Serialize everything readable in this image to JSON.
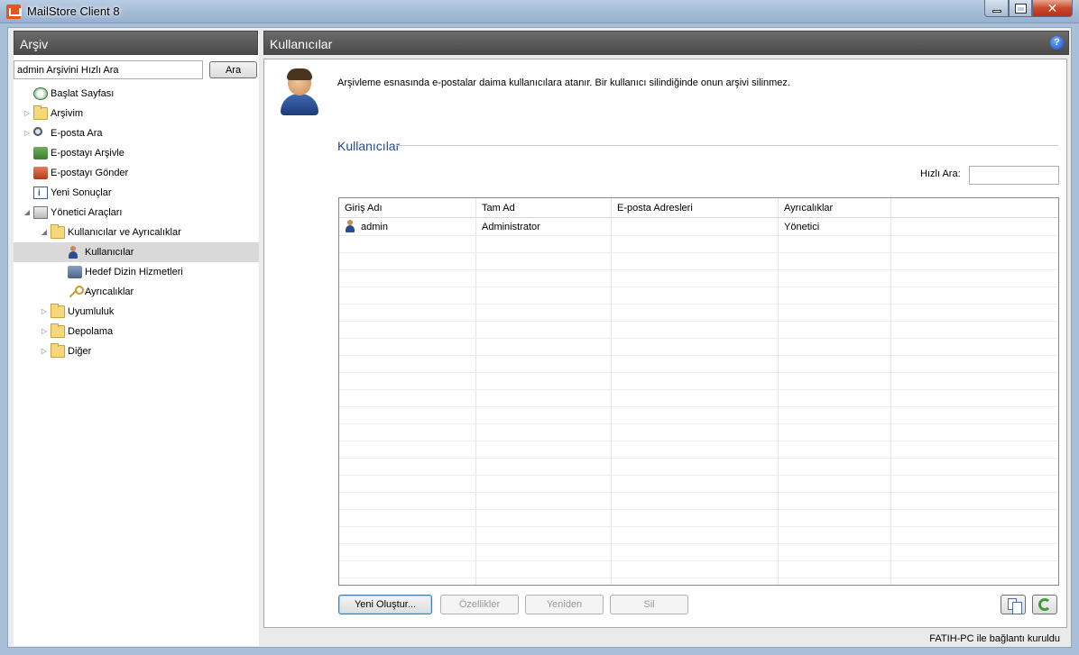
{
  "window": {
    "title": "MailStore Client 8"
  },
  "left": {
    "header": "Arşiv",
    "search_value": "admin Arşivini Hızlı Ara",
    "search_button": "Ara",
    "tree": [
      {
        "label": "Başlat Sayfası",
        "icon": "start-page-icon",
        "level": 0,
        "expander": "none"
      },
      {
        "label": "Arşivim",
        "icon": "folder-icon",
        "level": 0,
        "expander": "collapsed"
      },
      {
        "label": "E-posta Ara",
        "icon": "search-icon",
        "level": 0,
        "expander": "collapsed"
      },
      {
        "label": "E-postayı Arşivle",
        "icon": "archive-email-icon",
        "level": 0,
        "expander": "none"
      },
      {
        "label": "E-postayı Gönder",
        "icon": "send-email-icon",
        "level": 0,
        "expander": "none"
      },
      {
        "label": "Yeni Sonuçlar",
        "icon": "new-results-icon",
        "level": 0,
        "expander": "none"
      },
      {
        "label": "Yönetici Araçları",
        "icon": "admin-tools-icon",
        "level": 0,
        "expander": "expanded"
      },
      {
        "label": "Kullanıcılar ve Ayrıcalıklar",
        "icon": "folder-icon",
        "level": 1,
        "expander": "expanded"
      },
      {
        "label": "Kullanıcılar",
        "icon": "user-icon",
        "level": 2,
        "expander": "none",
        "selected": true
      },
      {
        "label": "Hedef Dizin Hizmetleri",
        "icon": "directory-services-icon",
        "level": 2,
        "expander": "none"
      },
      {
        "label": "Ayrıcalıklar",
        "icon": "key-icon",
        "level": 2,
        "expander": "none"
      },
      {
        "label": "Uyumluluk",
        "icon": "folder-icon",
        "level": 1,
        "expander": "collapsed"
      },
      {
        "label": "Depolama",
        "icon": "folder-icon",
        "level": 1,
        "expander": "collapsed"
      },
      {
        "label": "Diğer",
        "icon": "folder-icon",
        "level": 1,
        "expander": "collapsed"
      }
    ]
  },
  "right": {
    "header": "Kullanıcılar",
    "info": "Arşivleme esnasında e-postalar daima kullanıcılara atanır. Bir kullanıcı silindiğinde onun arşivi silinmez.",
    "section_title": "Kullanıcılar",
    "filter_label": "Hızlı Ara:",
    "filter_value": "",
    "columns": [
      "Giriş Adı",
      "Tam Ad",
      "E-posta Adresleri",
      "Ayrıcalıklar",
      ""
    ],
    "rows": [
      {
        "login": "admin",
        "full_name": "Administrator",
        "emails": "",
        "privileges": "Yönetici"
      }
    ],
    "buttons": {
      "create": "Yeni Oluştur...",
      "properties": "Özellikler",
      "rename": "Yeniden",
      "delete": "Sil"
    }
  },
  "status": {
    "text": "FATIH-PC ile bağlantı kuruldu"
  },
  "colors": {
    "header_bg": "#555555",
    "section_title": "#1f4b8f",
    "selection": "#d9d9d9"
  }
}
